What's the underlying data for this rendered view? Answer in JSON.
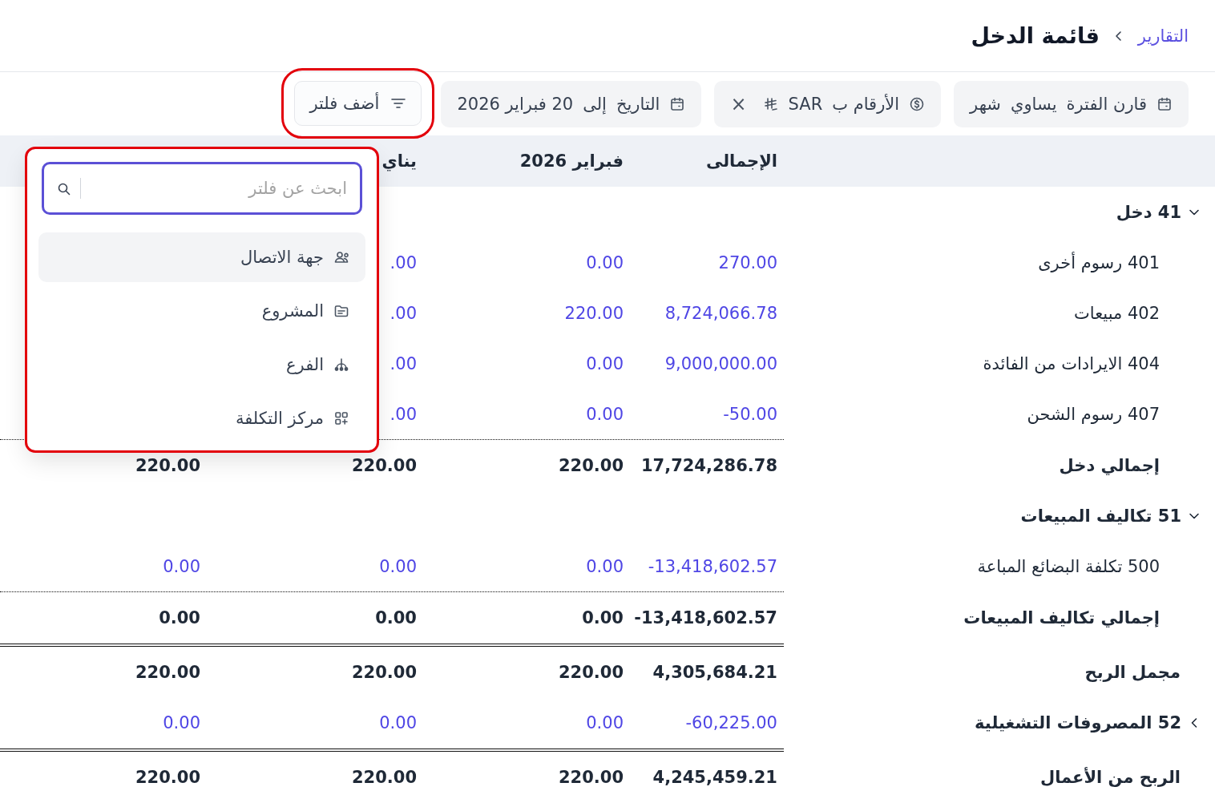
{
  "breadcrumb": {
    "link": "التقارير",
    "title": "قائمة الدخل"
  },
  "filters": [
    {
      "kind": "period",
      "parts": [
        "قارن الفترة",
        "يساوي",
        "شهر"
      ],
      "removable": false
    },
    {
      "kind": "currency",
      "parts": [
        "الأرقام ب",
        "SAR"
      ],
      "removable": true,
      "remove_label": "×"
    },
    {
      "kind": "date",
      "parts": [
        "التاريخ",
        "إلى",
        "20 فبراير 2026"
      ],
      "removable": false
    }
  ],
  "add_filter_button": {
    "label": "أضف فلتر",
    "highlighted": true
  },
  "filter_menu": {
    "highlighted": true,
    "search": {
      "placeholder": "ابحث عن فلتر",
      "focused": true
    },
    "items": [
      {
        "kind": "contact",
        "label": "جهة الاتصال",
        "selected": true
      },
      {
        "kind": "project",
        "label": "المشروع",
        "selected": false
      },
      {
        "kind": "branch",
        "label": "الفرع",
        "selected": false
      },
      {
        "kind": "cost_center",
        "label": "مركز التكلفة",
        "selected": false
      }
    ]
  },
  "table": {
    "columns": [
      {
        "label": "الإجمالى"
      },
      {
        "label": "فبراير 2026"
      },
      {
        "label": "يناي"
      }
    ],
    "rows": [
      {
        "kind": "group",
        "label": "41 دخل",
        "expanded": true,
        "values": []
      },
      {
        "kind": "account",
        "label": "401 رسوم أخرى",
        "values": [
          "270.00",
          "0.00",
          ".00"
        ]
      },
      {
        "kind": "account",
        "label": "402 مبيعات",
        "values": [
          "8,724,066.78",
          "220.00",
          ".00"
        ]
      },
      {
        "kind": "account",
        "label": "404 الايرادات من الفائدة",
        "values": [
          "9,000,000.00",
          "0.00",
          ".00"
        ]
      },
      {
        "kind": "account",
        "label": "407 رسوم الشحن",
        "values": [
          "-50.00",
          "0.00",
          ".00"
        ]
      },
      {
        "kind": "total",
        "label": "إجمالي دخل",
        "values": [
          "17,724,286.78",
          "220.00",
          "220.00",
          "220.00"
        ]
      },
      {
        "kind": "group",
        "label": "51 تكاليف المبيعات",
        "expanded": true,
        "values": []
      },
      {
        "kind": "account",
        "label": "500 تكلفة البضائع المباعة",
        "values": [
          "-13,418,602.57",
          "0.00",
          "0.00",
          "0.00"
        ]
      },
      {
        "kind": "total",
        "label": "إجمالي تكاليف المبيعات",
        "values": [
          "-13,418,602.57",
          "0.00",
          "0.00",
          "0.00"
        ]
      },
      {
        "kind": "summary",
        "label": "مجمل الربح",
        "values": [
          "4,305,684.21",
          "220.00",
          "220.00",
          "220.00"
        ]
      },
      {
        "kind": "group",
        "label": "52 المصروفات التشغيلية",
        "expanded": false,
        "values": [
          "-60,225.00",
          "0.00",
          "0.00",
          "0.00"
        ]
      },
      {
        "kind": "summary",
        "label": "الربح من الأعمال",
        "values": [
          "4,245,459.21",
          "220.00",
          "220.00",
          "220.00"
        ]
      }
    ]
  }
}
